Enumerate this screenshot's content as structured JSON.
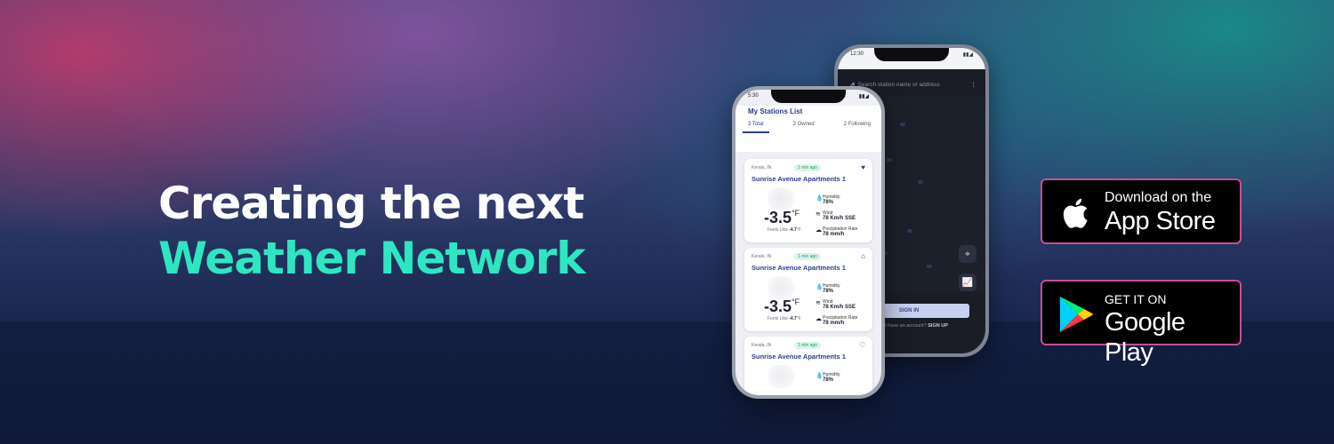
{
  "headline": {
    "line1": "Creating the next",
    "line2": "Weather Network"
  },
  "badges": {
    "apple": {
      "small": "Download on the",
      "big": "App Store",
      "icon": "apple-icon"
    },
    "google": {
      "small": "GET IT ON",
      "big": "Google Play",
      "icon": "google-play-icon"
    }
  },
  "back_phone": {
    "time": "12:30",
    "search_placeholder": "Search station name or address",
    "signin_label": "SIGN IN",
    "signup_text": "Don't have an account?",
    "signup_link": "SIGN UP"
  },
  "front_phone": {
    "time": "5:30",
    "title": "My Stations List",
    "tabs": [
      "3 Total",
      "3 Owned",
      "2 Following"
    ],
    "cards": [
      {
        "location": "Kerala, IN",
        "status": "1 min ago",
        "name": "Sunrise Avenue Apartments 1",
        "temp": "-3.5",
        "unit": "°F",
        "feels_label": "Feels Like",
        "feels_value": "-4.7",
        "feels_unit": "°F",
        "humidity_label": "Humidity",
        "humidity_value": "78%",
        "wind_label": "Wind",
        "wind_value": "78 Km/h SSE",
        "precip_label": "Precipitation Rate",
        "precip_value": "78 mm/h"
      },
      {
        "location": "Kerala, IN",
        "status": "1 min ago",
        "name": "Sunrise Avenue Apartments 1",
        "temp": "-3.5",
        "unit": "°F",
        "feels_label": "Feels Like",
        "feels_value": "-4.7",
        "feels_unit": "°F",
        "humidity_label": "Humidity",
        "humidity_value": "78%",
        "wind_label": "Wind",
        "wind_value": "78 Km/h SSE",
        "precip_label": "Precipitation Rate",
        "precip_value": "78 mm/h"
      },
      {
        "location": "Kerala, IN",
        "status": "1 min ago",
        "name": "Sunrise Avenue Apartments 1",
        "humidity_label": "Humidity",
        "humidity_value": "78%"
      }
    ]
  },
  "colors": {
    "headline_white": "#ffffff",
    "headline_accent": "#2ee6c2",
    "badge_border": "#c64f93",
    "brand_blue": "#2c3a8c"
  }
}
